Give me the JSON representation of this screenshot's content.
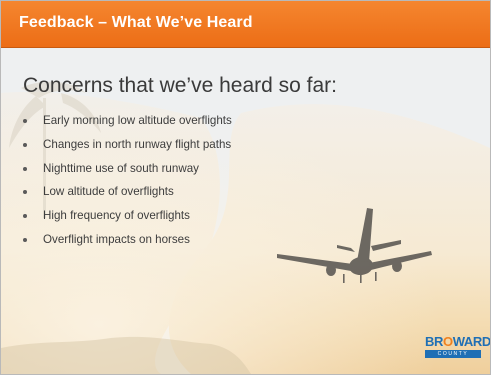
{
  "header": {
    "title": "Feedback – What We’ve Heard"
  },
  "main": {
    "heading": "Concerns that we’ve heard so far:",
    "bullets": [
      "Early morning low altitude overflights",
      "Changes in north runway flight paths",
      "Nighttime use of south runway",
      "Low altitude of overflights",
      "High frequency of overflights",
      "Overflight impacts on horses"
    ]
  },
  "logo": {
    "word_a": "BR",
    "word_b": "O",
    "word_c": "WARD",
    "sub": "COUNTY",
    "icon": "broward-county-logo"
  },
  "colors": {
    "header": "#ef7520",
    "text": "#3d3d3d",
    "brand_blue": "#1f6fb5",
    "brand_orange": "#f0811f"
  }
}
